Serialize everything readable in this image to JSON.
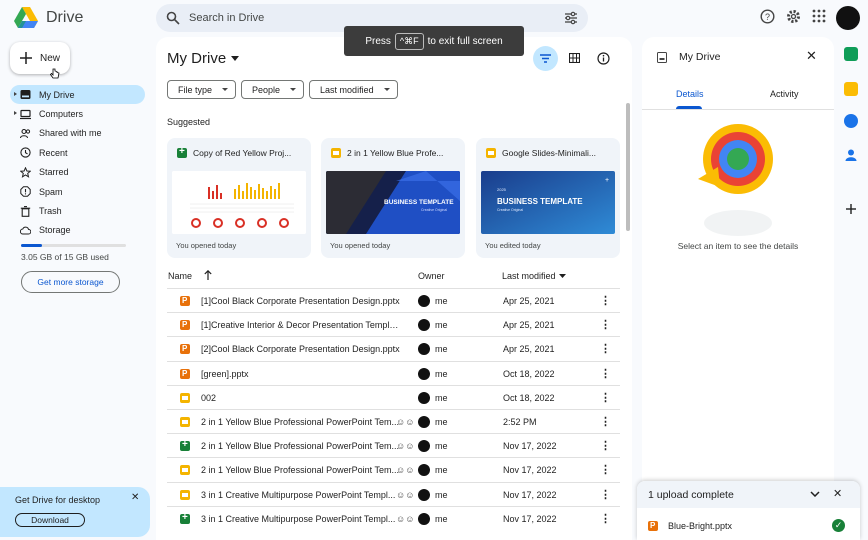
{
  "app": {
    "name": "Drive"
  },
  "search": {
    "placeholder": "Search in Drive"
  },
  "fullscreen_toast": {
    "prefix": "Press",
    "key": "^⌘F",
    "suffix": "to exit full screen"
  },
  "new_button": {
    "label": "New"
  },
  "nav": {
    "items": [
      {
        "label": "My Drive",
        "icon": "my-drive-icon",
        "active": true,
        "expandable": true
      },
      {
        "label": "Computers",
        "icon": "computer-icon",
        "active": false,
        "expandable": true
      },
      {
        "label": "Shared with me",
        "icon": "people-icon",
        "active": false,
        "expandable": false
      },
      {
        "label": "Recent",
        "icon": "clock-icon",
        "active": false,
        "expandable": false
      },
      {
        "label": "Starred",
        "icon": "star-icon",
        "active": false,
        "expandable": false
      },
      {
        "label": "Spam",
        "icon": "spam-icon",
        "active": false,
        "expandable": false
      },
      {
        "label": "Trash",
        "icon": "trash-icon",
        "active": false,
        "expandable": false
      },
      {
        "label": "Storage",
        "icon": "cloud-icon",
        "active": false,
        "expandable": false
      }
    ],
    "storage_used_fraction": 0.2,
    "storage_text": "3.05 GB of 15 GB used",
    "get_storage_label": "Get more storage"
  },
  "promo": {
    "title": "Get Drive for desktop",
    "button": "Download"
  },
  "main": {
    "title": "My Drive",
    "filters": [
      "File type",
      "People",
      "Last modified"
    ],
    "suggested_label": "Suggested",
    "suggested": [
      {
        "title": "Copy of Red Yellow Proj...",
        "type": "sheet",
        "subtitle": "You opened today"
      },
      {
        "title": "2 in 1 Yellow Blue Profe...",
        "type": "slides",
        "subtitle": "You opened today",
        "thumb_text": "BUSINESS TEMPLATE",
        "thumb_sub": "Creative Original"
      },
      {
        "title": "Google Slides-Minimali...",
        "type": "slides",
        "subtitle": "You edited today",
        "thumb_text": "BUSINESS TEMPLATE",
        "thumb_year": "2025",
        "thumb_sub": "Creative Original"
      }
    ],
    "columns": {
      "name": "Name",
      "owner": "Owner",
      "modified": "Last modified"
    },
    "rows": [
      {
        "name": "[1]Cool Black Corporate Presentation Design.pptx",
        "type": "pptx",
        "shared": false,
        "owner": "me",
        "modified": "Apr 25, 2021"
      },
      {
        "name": "[1]Creative Interior & Decor Presentation Template...",
        "type": "pptx",
        "shared": false,
        "owner": "me",
        "modified": "Apr 25, 2021"
      },
      {
        "name": "[2]Cool Black Corporate Presentation Design.pptx",
        "type": "pptx",
        "shared": false,
        "owner": "me",
        "modified": "Apr 25, 2021"
      },
      {
        "name": "[green].pptx",
        "type": "pptx",
        "shared": false,
        "owner": "me",
        "modified": "Oct 18, 2022"
      },
      {
        "name": "002",
        "type": "slides",
        "shared": false,
        "owner": "me",
        "modified": "Oct 18, 2022"
      },
      {
        "name": "2 in 1 Yellow Blue Professional PowerPoint Tem...",
        "type": "slides",
        "shared": true,
        "owner": "me",
        "modified": "2:52 PM"
      },
      {
        "name": "2 in 1 Yellow Blue Professional PowerPoint Tem...",
        "type": "sheet",
        "shared": true,
        "owner": "me",
        "modified": "Nov 17, 2022"
      },
      {
        "name": "2 in 1 Yellow Blue Professional PowerPoint Tem...",
        "type": "slides",
        "shared": true,
        "owner": "me",
        "modified": "Nov 17, 2022"
      },
      {
        "name": "3 in 1 Creative Multipurpose PowerPoint Templ...",
        "type": "slides",
        "shared": true,
        "owner": "me",
        "modified": "Nov 17, 2022"
      },
      {
        "name": "3 in 1 Creative Multipurpose PowerPoint Templ...",
        "type": "sheet",
        "shared": true,
        "owner": "me",
        "modified": "Nov 17, 2022"
      }
    ]
  },
  "details": {
    "title": "My Drive",
    "tabs": [
      "Details",
      "Activity"
    ],
    "empty_text": "Select an item to see the details"
  },
  "upload": {
    "title": "1 upload complete",
    "file": "Blue-Bright.pptx"
  },
  "colors": {
    "accent": "#0b57d0",
    "active_bg": "#c2e7ff",
    "background": "#f8fafd"
  }
}
